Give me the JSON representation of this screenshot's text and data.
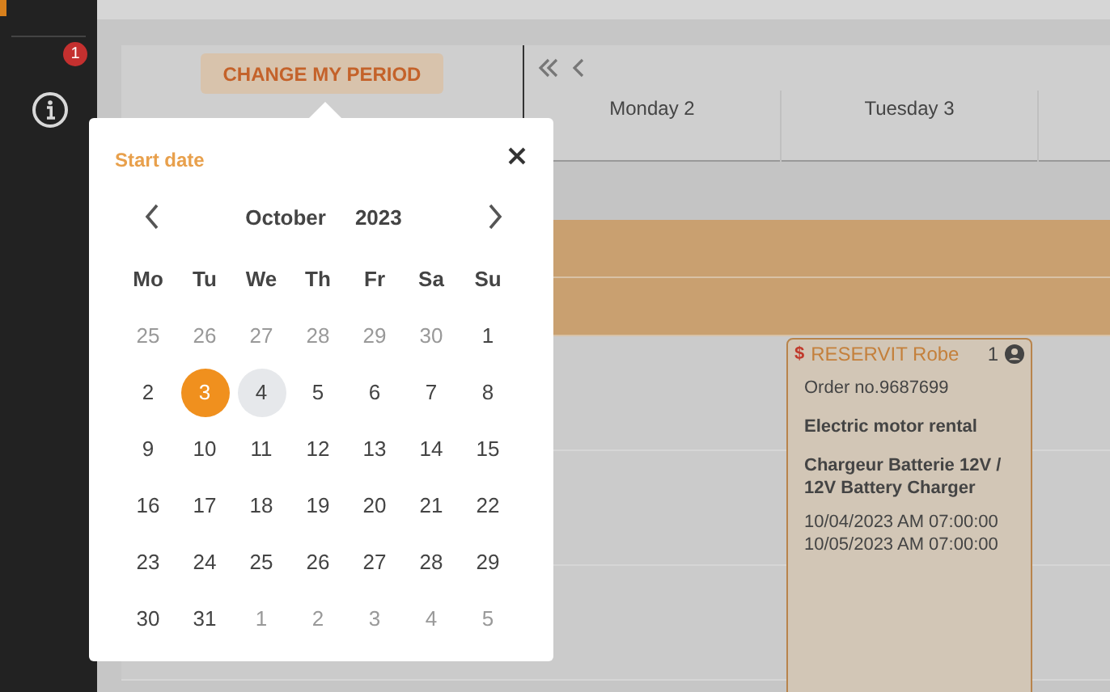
{
  "sidebar": {
    "notification_badge": "1"
  },
  "header": {
    "change_period_button": "CHANGE MY PERIOD",
    "days": [
      {
        "label": "Monday 2"
      },
      {
        "label": "Tuesday 3"
      }
    ]
  },
  "date_picker": {
    "title": "Start date",
    "month": "October",
    "year": "2023",
    "weekdays": [
      "Mo",
      "Tu",
      "We",
      "Th",
      "Fr",
      "Sa",
      "Su"
    ],
    "days": [
      {
        "label": "25",
        "outside": true,
        "selected": false,
        "today": false
      },
      {
        "label": "26",
        "outside": true,
        "selected": false,
        "today": false
      },
      {
        "label": "27",
        "outside": true,
        "selected": false,
        "today": false
      },
      {
        "label": "28",
        "outside": true,
        "selected": false,
        "today": false
      },
      {
        "label": "29",
        "outside": true,
        "selected": false,
        "today": false
      },
      {
        "label": "30",
        "outside": true,
        "selected": false,
        "today": false
      },
      {
        "label": "1",
        "outside": false,
        "selected": false,
        "today": false
      },
      {
        "label": "2",
        "outside": false,
        "selected": false,
        "today": false
      },
      {
        "label": "3",
        "outside": false,
        "selected": true,
        "today": false
      },
      {
        "label": "4",
        "outside": false,
        "selected": false,
        "today": true
      },
      {
        "label": "5",
        "outside": false,
        "selected": false,
        "today": false
      },
      {
        "label": "6",
        "outside": false,
        "selected": false,
        "today": false
      },
      {
        "label": "7",
        "outside": false,
        "selected": false,
        "today": false
      },
      {
        "label": "8",
        "outside": false,
        "selected": false,
        "today": false
      },
      {
        "label": "9",
        "outside": false,
        "selected": false,
        "today": false
      },
      {
        "label": "10",
        "outside": false,
        "selected": false,
        "today": false
      },
      {
        "label": "11",
        "outside": false,
        "selected": false,
        "today": false
      },
      {
        "label": "12",
        "outside": false,
        "selected": false,
        "today": false
      },
      {
        "label": "13",
        "outside": false,
        "selected": false,
        "today": false
      },
      {
        "label": "14",
        "outside": false,
        "selected": false,
        "today": false
      },
      {
        "label": "15",
        "outside": false,
        "selected": false,
        "today": false
      },
      {
        "label": "16",
        "outside": false,
        "selected": false,
        "today": false
      },
      {
        "label": "17",
        "outside": false,
        "selected": false,
        "today": false
      },
      {
        "label": "18",
        "outside": false,
        "selected": false,
        "today": false
      },
      {
        "label": "19",
        "outside": false,
        "selected": false,
        "today": false
      },
      {
        "label": "20",
        "outside": false,
        "selected": false,
        "today": false
      },
      {
        "label": "21",
        "outside": false,
        "selected": false,
        "today": false
      },
      {
        "label": "22",
        "outside": false,
        "selected": false,
        "today": false
      },
      {
        "label": "23",
        "outside": false,
        "selected": false,
        "today": false
      },
      {
        "label": "24",
        "outside": false,
        "selected": false,
        "today": false
      },
      {
        "label": "25",
        "outside": false,
        "selected": false,
        "today": false
      },
      {
        "label": "26",
        "outside": false,
        "selected": false,
        "today": false
      },
      {
        "label": "27",
        "outside": false,
        "selected": false,
        "today": false
      },
      {
        "label": "28",
        "outside": false,
        "selected": false,
        "today": false
      },
      {
        "label": "29",
        "outside": false,
        "selected": false,
        "today": false
      },
      {
        "label": "30",
        "outside": false,
        "selected": false,
        "today": false
      },
      {
        "label": "31",
        "outside": false,
        "selected": false,
        "today": false
      },
      {
        "label": "1",
        "outside": true,
        "selected": false,
        "today": false
      },
      {
        "label": "2",
        "outside": true,
        "selected": false,
        "today": false
      },
      {
        "label": "3",
        "outside": true,
        "selected": false,
        "today": false
      },
      {
        "label": "4",
        "outside": true,
        "selected": false,
        "today": false
      },
      {
        "label": "5",
        "outside": true,
        "selected": false,
        "today": false
      }
    ]
  },
  "event": {
    "currency": "$",
    "title": "RESERVIT Robe",
    "count": "1",
    "order": "Order no.9687699",
    "service": "Electric motor rental",
    "item": "Chargeur Batterie 12V / 12V Battery Charger",
    "start": "10/04/2023 AM 07:00:00",
    "end": "10/05/2023 AM 07:00:00"
  }
}
